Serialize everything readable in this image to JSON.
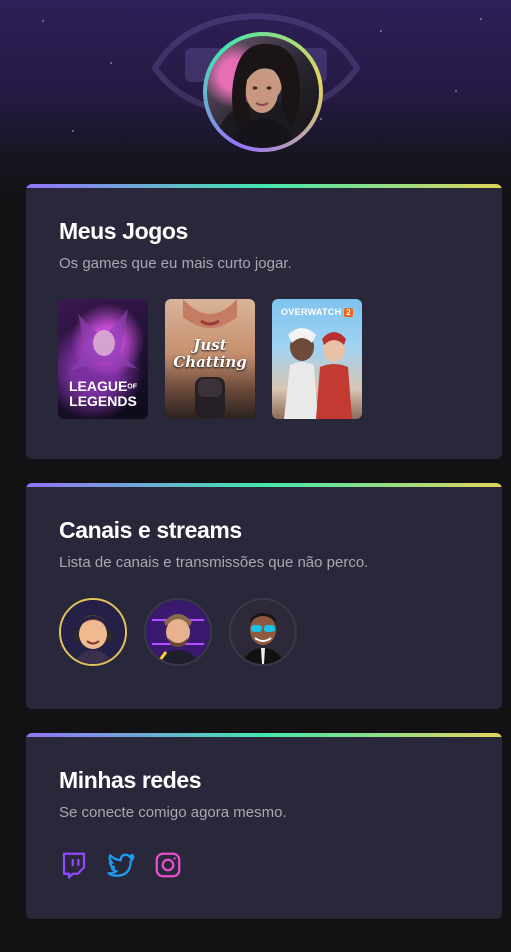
{
  "profile": {
    "avatar_icon": "profile-photo"
  },
  "sections": {
    "games": {
      "title": "Meus Jogos",
      "subtitle": "Os games que eu mais curto jogar.",
      "items": [
        {
          "name": "LEAGUE OF LEGENDS",
          "line1": "LEAGUE",
          "line2": "OF",
          "line3": "LEGENDS"
        },
        {
          "name": "Just Chatting",
          "line1": "Just",
          "line2": "Chatting"
        },
        {
          "name": "OVERWATCH 2",
          "line1": "OVERWATCH",
          "badge": "2"
        }
      ]
    },
    "channels": {
      "title": "Canais e streams",
      "subtitle": "Lista de canais e transmissões que não perco.",
      "items": [
        {
          "icon": "streamer-avatar-1",
          "live": true
        },
        {
          "icon": "streamer-avatar-2",
          "live": false
        },
        {
          "icon": "streamer-avatar-3",
          "live": false
        }
      ]
    },
    "socials": {
      "title": "Minhas redes",
      "subtitle": "Se conecte comigo agora mesmo.",
      "items": [
        {
          "icon": "twitch-icon",
          "color": "#9146ff"
        },
        {
          "icon": "twitter-icon",
          "color": "#1d9bf0"
        },
        {
          "icon": "instagram-icon",
          "color": "#e54fd0"
        }
      ]
    }
  },
  "colors": {
    "background": "#121214",
    "card": "#29273a",
    "gradient": [
      "#9572fc",
      "#43e7ad",
      "#e2d45c"
    ]
  }
}
